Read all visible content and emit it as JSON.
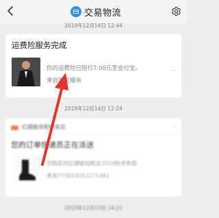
{
  "header": {
    "title": "交易物流",
    "back_icon": "chevron-left-icon",
    "title_icon": "logistics-icon",
    "settings_icon": "gear-icon",
    "title_icon_color": "#2f90e9"
  },
  "messages": [
    {
      "timestamp": "2019年12月14日 12:44",
      "title": "运费险服务完成",
      "body": "你的运费险已赔付7.00元至支付宝。",
      "more": "...",
      "source": "来自淘宝服务"
    },
    {
      "timestamp": "2019年12月14日 12:24",
      "shop": "红蜻蜓郑和特卖店",
      "title": "您的订单快递员正在派送",
      "body": "您购买的红蜻蜓短靴女2019秋冬新款",
      "tracking": "来自773019252271481"
    },
    {
      "timestamp": "2019年12月13日 14:22"
    }
  ],
  "annotation": {
    "arrow_color": "#e5342b",
    "arrow_icon": "red-arrow-annotation"
  }
}
